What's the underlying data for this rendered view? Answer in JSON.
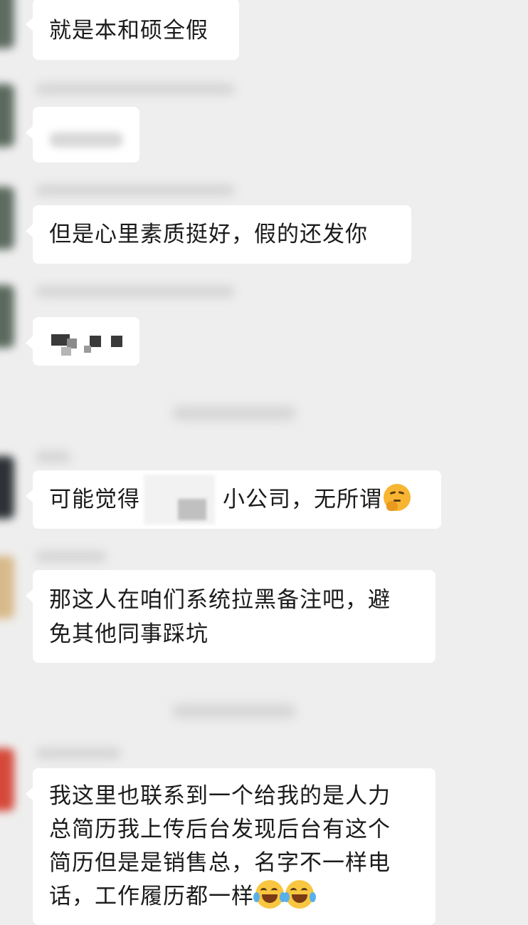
{
  "messages": [
    {
      "text": "就是本和硕全假"
    },
    {
      "text": "但是心里素质挺好，假的还发你"
    },
    {
      "text_before": "可能觉得",
      "text_after": "小公司，无所谓",
      "emoji": "thinking-face-icon"
    },
    {
      "line1": "那这人在咱们系统拉黑备注吧，避",
      "line2": "免其他同事踩坑"
    },
    {
      "line1": "我这里也联系到一个给我的是人力",
      "line2": "总简历我上传后台发现后台有这个",
      "line3": "简历但是是销售总，名字不一样电",
      "line4": "话，工作履历都一样",
      "emojis": [
        "face-with-tears-of-joy-icon",
        "face-with-tears-of-joy-icon"
      ]
    }
  ],
  "colors": {
    "background": "#eeeeee",
    "bubble": "#ffffff",
    "text": "#1b1b1b"
  }
}
